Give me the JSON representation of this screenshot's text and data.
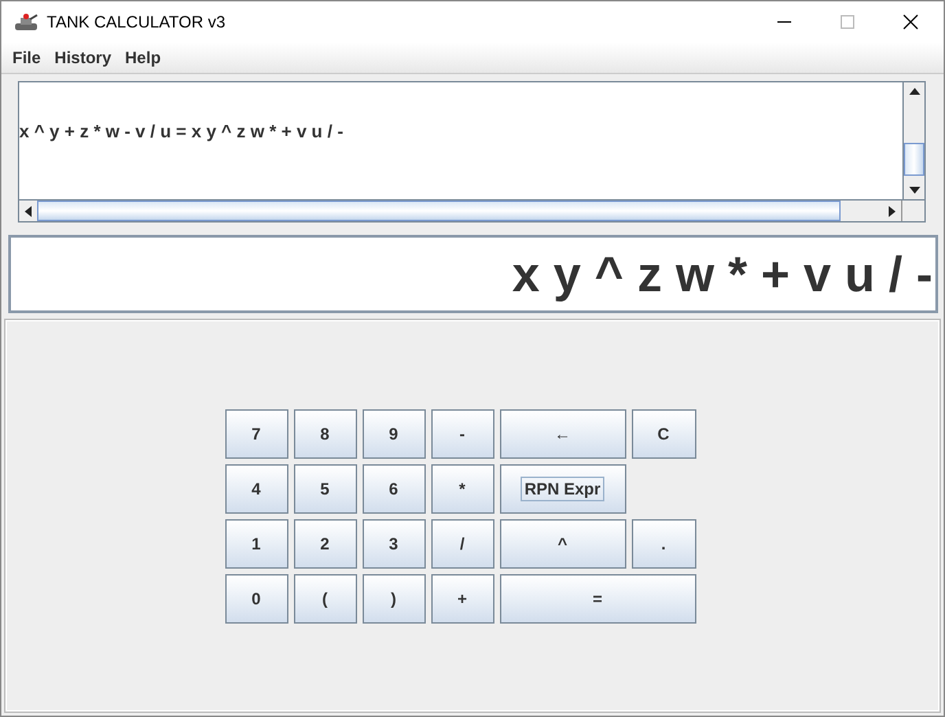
{
  "window": {
    "title": "TANK CALCULATOR v3"
  },
  "menu": [
    "File",
    "History",
    "Help"
  ],
  "history": {
    "lines": [
      "x ^ y + z * w - v / u =  x y ^ z w * + v u / -"
    ]
  },
  "display": {
    "value": "x y ^ z w * + v u / -"
  },
  "keypad": {
    "rows": [
      [
        {
          "label": "7",
          "focused": false
        },
        {
          "label": "8",
          "focused": false
        },
        {
          "label": "9",
          "focused": false
        },
        {
          "label": "-",
          "focused": false
        },
        {
          "label": "←",
          "focused": false
        },
        {
          "label": "C",
          "focused": false
        }
      ],
      [
        {
          "label": "4",
          "focused": false
        },
        {
          "label": "5",
          "focused": false
        },
        {
          "label": "6",
          "focused": false
        },
        {
          "label": "*",
          "focused": false
        },
        {
          "label": "RPN Expr",
          "focused": true
        }
      ],
      [
        {
          "label": "1",
          "focused": false
        },
        {
          "label": "2",
          "focused": false
        },
        {
          "label": "3",
          "focused": false
        },
        {
          "label": "/",
          "focused": false
        },
        {
          "label": "^",
          "focused": false
        },
        {
          "label": ".",
          "focused": false
        }
      ],
      [
        {
          "label": "0",
          "focused": false
        },
        {
          "label": "(",
          "focused": false
        },
        {
          "label": ")",
          "focused": false
        },
        {
          "label": "+",
          "focused": false
        },
        {
          "label": "=",
          "focused": false
        }
      ]
    ]
  }
}
